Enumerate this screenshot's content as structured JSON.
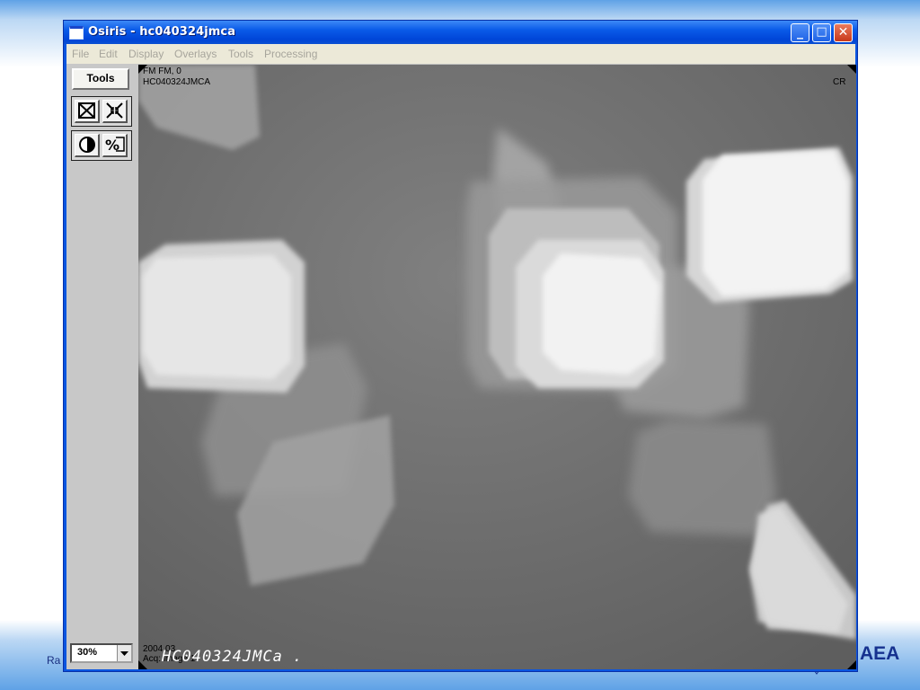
{
  "window": {
    "title": "Osiris - hc040324jmca",
    "controls": {
      "minimize": "_",
      "maximize": "□",
      "close": "✕"
    }
  },
  "menu": [
    "File",
    "Edit",
    "Display",
    "Overlays",
    "Tools",
    "Processing"
  ],
  "left_panel": {
    "tools_label": "Tools",
    "buttons": [
      "fit-to-window-icon",
      "zoom-shrink-icon",
      "contrast-icon",
      "percent-icon"
    ],
    "zoom_value": "30%"
  },
  "image_overlay": {
    "top_left_line1": "FM FM, 0",
    "top_left_line2": "HC040324JMCA",
    "top_right": "CR",
    "bottom_left_line1": "2004.03",
    "bottom_left_line2": "Acq: image 1",
    "handwritten_label": "HC040324JMCa ."
  },
  "slide": {
    "footer_left": "Ra",
    "logo_text": "AEA"
  },
  "colors": {
    "title_bar": "#0a5ae8",
    "image_background": "#6e6e6e",
    "logo": "#16318f"
  }
}
